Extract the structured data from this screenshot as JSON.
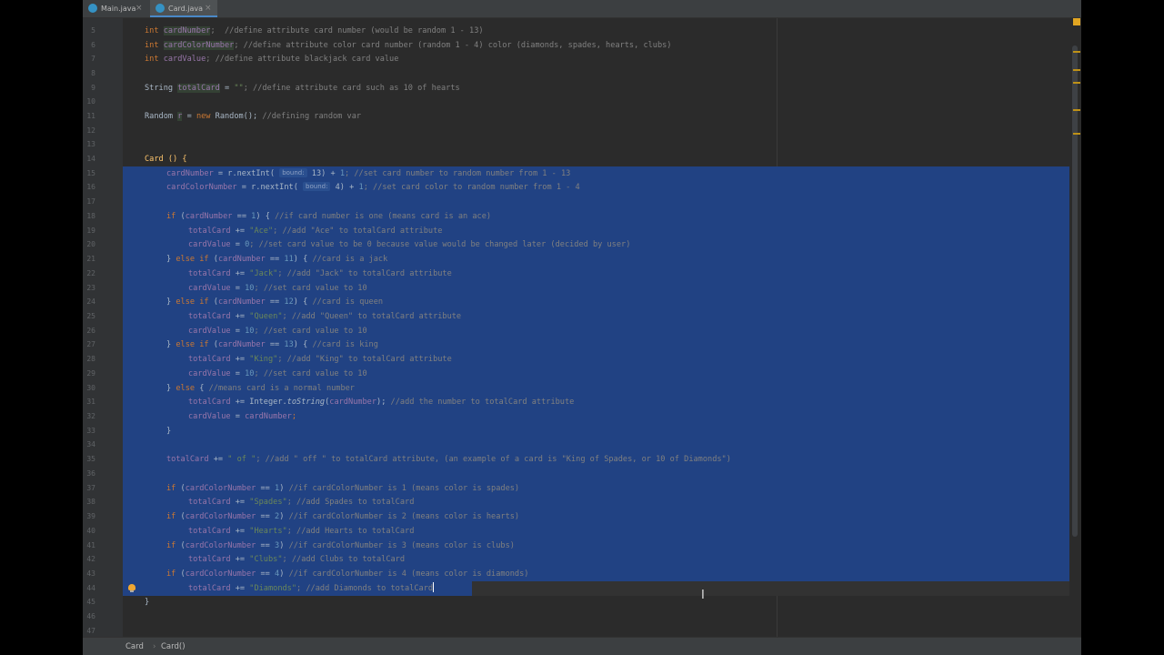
{
  "tabs": [
    {
      "label": "Main.java",
      "active": false
    },
    {
      "label": "Card.java",
      "active": true
    }
  ],
  "line_numbers": [
    "5",
    "6",
    "7",
    "8",
    "9",
    "10",
    "11",
    "12",
    "13",
    "14",
    "15",
    "16",
    "17",
    "18",
    "19",
    "20",
    "21",
    "22",
    "23",
    "24",
    "25",
    "26",
    "27",
    "28",
    "29",
    "30",
    "31",
    "32",
    "33",
    "34",
    "35",
    "36",
    "37",
    "38",
    "39",
    "40",
    "41",
    "42",
    "43",
    "44",
    "45",
    "46",
    "47"
  ],
  "code": {
    "l5": [
      "int ",
      "cardNumber",
      ";  //define attribute card number (would be random 1 - 13)"
    ],
    "l6": [
      "int ",
      "cardColorNumber",
      "; //define attribute color card number (random 1 - 4) color (diamonds, spades, hearts, clubs)"
    ],
    "l7": [
      "int ",
      "cardValue",
      "; //define attribute blackjack card value"
    ],
    "l9": [
      "String ",
      "totalCard",
      " = ",
      "\"\"",
      "; //define attribute card such as 10 of hearts"
    ],
    "l11": [
      "Random ",
      "r",
      " = ",
      "new ",
      "Random(); ",
      "//defining random var"
    ],
    "l14": [
      "Card () {"
    ],
    "l15": [
      "cardNumber",
      " = r.nextInt( ",
      "bound:",
      " 13) + ",
      "1",
      "; //set card number to random number from 1 - 13"
    ],
    "l16": [
      "cardColorNumber",
      " = r.nextInt( ",
      "bound:",
      " 4) + ",
      "1",
      "; //set card color to random number from 1 - 4"
    ],
    "l18": [
      "if ",
      "(",
      "cardNumber",
      " == ",
      "1",
      ") { ",
      "//if card number is one (means card is an ace)"
    ],
    "l19": [
      "totalCard",
      " += ",
      "\"Ace\"",
      "; //add \"Ace\" to totalCard attribute"
    ],
    "l20": [
      "cardValue",
      " = ",
      "0",
      "; //set card value to be 0 because value would be changed later (decided by user)"
    ],
    "l21": [
      "} ",
      "else if ",
      "(",
      "cardNumber",
      " == ",
      "11",
      ") { ",
      "//card is a jack"
    ],
    "l22": [
      "totalCard",
      " += ",
      "\"Jack\"",
      "; //add \"Jack\" to totalCard attribute"
    ],
    "l23": [
      "cardValue",
      " = ",
      "10",
      "; //set card value to 10"
    ],
    "l24": [
      "} ",
      "else if ",
      "(",
      "cardNumber",
      " == ",
      "12",
      ") { ",
      "//card is queen"
    ],
    "l25": [
      "totalCard",
      " += ",
      "\"Queen\"",
      "; //add \"Queen\" to totalCard attribute"
    ],
    "l26": [
      "cardValue",
      " = ",
      "10",
      "; //set card value to 10"
    ],
    "l27": [
      "} ",
      "else if ",
      "(",
      "cardNumber",
      " == ",
      "13",
      ") { ",
      "//card is king"
    ],
    "l28": [
      "totalCard",
      " += ",
      "\"King\"",
      "; //add \"King\" to totalCard attribute"
    ],
    "l29": [
      "cardValue",
      " = ",
      "10",
      "; //set card value to 10"
    ],
    "l30": [
      "} ",
      "else ",
      "{ ",
      "//means card is a normal number"
    ],
    "l31": [
      "totalCard",
      " += Integer.",
      "toString",
      "(",
      "cardNumber",
      "); ",
      "//add the number to totalCard attribute"
    ],
    "l32": [
      "cardValue",
      " = ",
      "cardNumber",
      ";"
    ],
    "l33": [
      "}"
    ],
    "l35": [
      "totalCard",
      " += ",
      "\" of \"",
      "; //add \" off \" to totalCard attribute, (an example of a card is \"King of Spades, or 10 of Diamonds\")"
    ],
    "l37": [
      "if ",
      "(",
      "cardColorNumber",
      " == ",
      "1",
      ") ",
      "//if cardColorNumber is 1 (means color is spades)"
    ],
    "l38": [
      "totalCard",
      " += ",
      "\"Spades\"",
      "; //add Spades to totalCard"
    ],
    "l39": [
      "if ",
      "(",
      "cardColorNumber",
      " == ",
      "2",
      ") ",
      "//if cardColorNumber is 2 (means color is hearts)"
    ],
    "l40": [
      "totalCard",
      " += ",
      "\"Hearts\"",
      "; //add Hearts to totalCard"
    ],
    "l41": [
      "if ",
      "(",
      "cardColorNumber",
      " == ",
      "3",
      ") ",
      "//if cardColorNumber is 3 (means color is clubs)"
    ],
    "l42": [
      "totalCard",
      " += ",
      "\"Clubs\"",
      "; //add Clubs to totalCard"
    ],
    "l43": [
      "if ",
      "(",
      "cardColorNumber",
      " == ",
      "4",
      ") ",
      "//if cardColorNumber is 4 (means color is diamonds)"
    ],
    "l44": [
      "totalCard",
      " += ",
      "\"Diamonds\"",
      "; //add Diamonds to totalCard"
    ],
    "l46": [
      "}"
    ]
  },
  "status": {
    "breadcrumb_class": "Card",
    "breadcrumb_method": "Card()"
  },
  "colors": {
    "selection": "#214283",
    "background": "#2b2b2b",
    "keyword": "#cc7832",
    "field": "#9876aa",
    "string": "#6a8759",
    "comment": "#808080"
  },
  "icons": [
    "java-class-icon",
    "close-icon",
    "bulb-icon",
    "text-cursor-icon"
  ]
}
